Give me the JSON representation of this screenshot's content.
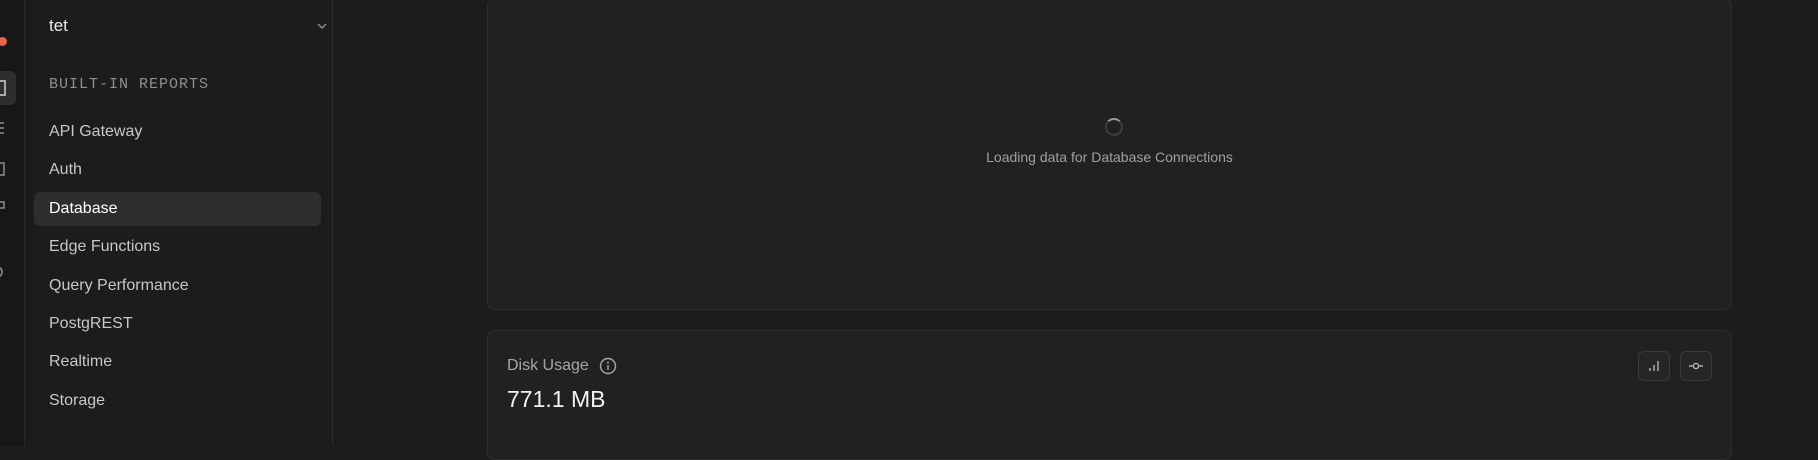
{
  "sidebar": {
    "project_name": "tet",
    "section_title": "BUILT-IN REPORTS",
    "items": [
      {
        "label": "API Gateway"
      },
      {
        "label": "Auth"
      },
      {
        "label": "Database",
        "active": true
      },
      {
        "label": "Edge Functions"
      },
      {
        "label": "Query Performance"
      },
      {
        "label": "PostgREST"
      },
      {
        "label": "Realtime"
      },
      {
        "label": "Storage"
      }
    ]
  },
  "main": {
    "connections_card": {
      "loading_text": "Loading data for Database Connections"
    },
    "disk_card": {
      "label": "Disk Usage",
      "value": "771.1 MB",
      "chart_toggle_icon": "bar-chart-icon",
      "expand_icon": "commit-icon"
    }
  },
  "colors": {
    "background": "#1c1c1c",
    "card": "#212121",
    "active_item": "#2e2e2e",
    "notification_dot": "#e5644a"
  }
}
